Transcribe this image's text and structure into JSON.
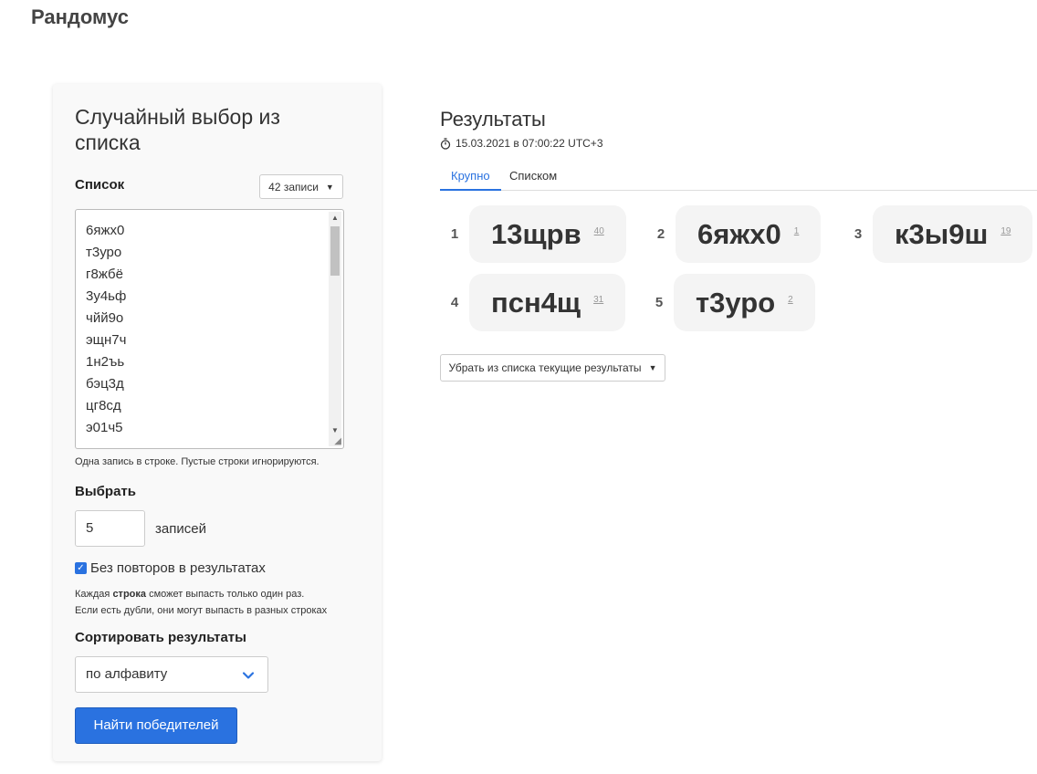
{
  "brand": "Рандомус",
  "form": {
    "title": "Случайный выбор из списка",
    "list_label": "Список",
    "count_button": "42 записи",
    "list_items": [
      "6яжх0",
      "т3уро",
      "г8жбё",
      "3у4ьф",
      "чйй9о",
      "эщн7ч",
      "1н2ъь",
      "бэц3д",
      "цг8сд",
      "э01ч5"
    ],
    "list_hint": "Одна запись в строке. Пустые строки игнорируются.",
    "pick_label": "Выбрать",
    "pick_value": "5",
    "pick_suffix": "записей",
    "no_repeat_checked": true,
    "no_repeat_label": "Без повторов в результатах",
    "no_repeat_note_prefix": "Каждая ",
    "no_repeat_note_bold": "строка",
    "no_repeat_note_suffix": " сможет выпасть только один раз.",
    "no_repeat_note_line2": "Если есть дубли, они могут выпасть в разных строках",
    "sort_label": "Сортировать результаты",
    "sort_value": "по алфавиту",
    "submit_label": "Найти победителей"
  },
  "results": {
    "title": "Результаты",
    "timestamp": "15.03.2021 в 07:00:22 UTC+3",
    "tabs": [
      "Крупно",
      "Списком"
    ],
    "items": [
      {
        "index": "1",
        "word": "13щрв",
        "line": "40"
      },
      {
        "index": "2",
        "word": "6яжх0",
        "line": "1"
      },
      {
        "index": "3",
        "word": "к3ы9ш",
        "line": "19"
      },
      {
        "index": "4",
        "word": "псн4щ",
        "line": "31"
      },
      {
        "index": "5",
        "word": "т3уро",
        "line": "2"
      }
    ],
    "remove_button": "Убрать из списка текущие результаты"
  },
  "colors": {
    "accent": "#2a72e0",
    "panel_bg": "#f9f9f9",
    "pill_bg": "#f4f4f4"
  }
}
